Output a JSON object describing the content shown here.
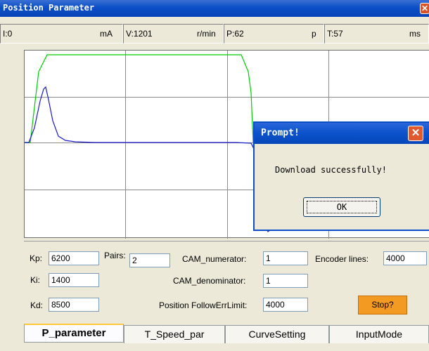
{
  "window": {
    "title": "Position Parameter",
    "close_glyph": "✕"
  },
  "status": {
    "i_value": "I:0",
    "i_unit": "mA",
    "v_value": "V:1201",
    "v_unit": "r/min",
    "p_value": "P:62",
    "p_unit": "p",
    "t_value": "T:57",
    "t_unit": "ms"
  },
  "scope": {
    "grid": true,
    "trace_colors": {
      "reference": "#00cc00",
      "response": "#1a1acc"
    }
  },
  "dialog": {
    "title": "Prompt!",
    "close_glyph": "✕",
    "message": "Download successfully!",
    "ok_label": "OK"
  },
  "params": {
    "kp_label": "Kp:",
    "kp_value": "6200",
    "ki_label": "Ki:",
    "ki_value": "1400",
    "kd_label": "Kd:",
    "kd_value": "8500",
    "pairs_label": "Pairs:",
    "pairs_value": "2",
    "cam_num_label": "CAM_numerator:",
    "cam_num_value": "1",
    "cam_den_label": "CAM_denominator:",
    "cam_den_value": "1",
    "follow_label": "Position FollowErrLimit:",
    "follow_value": "4000",
    "encoder_label": "Encoder lines:",
    "encoder_value": "4000",
    "stop_label": "Stop?"
  },
  "tabs": [
    {
      "label": "P_parameter",
      "active": true
    },
    {
      "label": "T_Speed_par",
      "active": false
    },
    {
      "label": "CurveSetting",
      "active": false
    },
    {
      "label": "InputMode",
      "active": false
    }
  ]
}
